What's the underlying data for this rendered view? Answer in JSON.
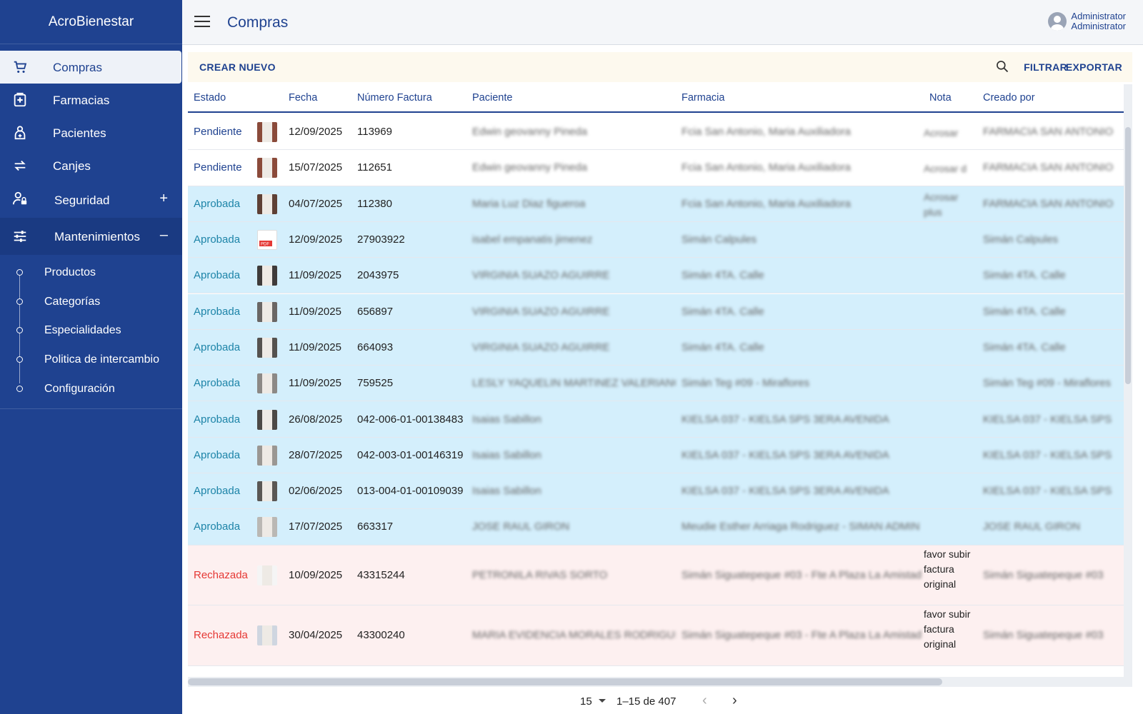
{
  "app": {
    "brand": "AcroBienestar"
  },
  "header": {
    "title": "Compras",
    "user_name": "Administrator",
    "user_role": "Administrator"
  },
  "sidebar": {
    "items": [
      {
        "label": "Compras",
        "icon": "cart-icon"
      },
      {
        "label": "Farmacias",
        "icon": "pharmacy-icon"
      },
      {
        "label": "Pacientes",
        "icon": "patient-icon"
      },
      {
        "label": "Canjes",
        "icon": "swap-icon"
      },
      {
        "label": "Seguridad",
        "icon": "user-lock-icon",
        "toggle": "+"
      },
      {
        "label": "Mantenimientos",
        "icon": "sliders-icon",
        "toggle": "–"
      }
    ],
    "submenu": [
      "Productos",
      "Categorías",
      "Especialidades",
      "Politica de intercambio",
      "Configuración"
    ]
  },
  "toolbar": {
    "create": "CREAR NUEVO",
    "filter": "FILTRAR",
    "export": "EXPORTAR"
  },
  "table": {
    "headers": {
      "estado": "Estado",
      "fecha": "Fecha",
      "numero": "Número Factura",
      "paciente": "Paciente",
      "farmacia": "Farmacia",
      "nota": "Nota",
      "creado": "Creado por"
    },
    "rows": [
      {
        "estado": "Pendiente",
        "status": "pend",
        "fecha": "12/09/2025",
        "numero": "113969",
        "paciente": "Edwin geovanny Pineda",
        "farmacia": "Fcia San Antonio, Maria Auxiliadora",
        "nota": "Acrosar",
        "creado": "FARMACIA SAN ANTONIO"
      },
      {
        "estado": "Pendiente",
        "status": "pend",
        "fecha": "15/07/2025",
        "numero": "112651",
        "paciente": "Edwin geovanny Pineda",
        "farmacia": "Fcia San Antonio, Maria Auxiliadora",
        "nota": "Acrosar d",
        "creado": "FARMACIA SAN ANTONIO"
      },
      {
        "estado": "Aprobada",
        "status": "apr",
        "fecha": "04/07/2025",
        "numero": "112380",
        "paciente": "Maria Luz Diaz figueroa",
        "farmacia": "Fcia San Antonio, Maria Auxiliadora",
        "nota": "Acrosar plus",
        "creado": "FARMACIA SAN ANTONIO"
      },
      {
        "estado": "Aprobada",
        "status": "apr",
        "fecha": "12/09/2025",
        "numero": "27903922",
        "paciente": "isabel empanatis jimenez",
        "farmacia": "Simán Calpules",
        "nota": "",
        "creado": "Simán Calpules"
      },
      {
        "estado": "Aprobada",
        "status": "apr",
        "fecha": "11/09/2025",
        "numero": "2043975",
        "paciente": "VIRGINIA SUAZO AGUIRRE",
        "farmacia": "Simán 4TA. Calle",
        "nota": "",
        "creado": "Simán 4TA. Calle"
      },
      {
        "estado": "Aprobada",
        "status": "apr",
        "fecha": "11/09/2025",
        "numero": "656897",
        "paciente": "VIRGINIA SUAZO AGUIRRE",
        "farmacia": "Simán 4TA. Calle",
        "nota": "",
        "creado": "Simán 4TA. Calle"
      },
      {
        "estado": "Aprobada",
        "status": "apr",
        "fecha": "11/09/2025",
        "numero": "664093",
        "paciente": "VIRGINIA SUAZO AGUIRRE",
        "farmacia": "Simán 4TA. Calle",
        "nota": "",
        "creado": "Simán 4TA. Calle"
      },
      {
        "estado": "Aprobada",
        "status": "apr",
        "fecha": "11/09/2025",
        "numero": "759525",
        "paciente": "LESLY YAQUELIN MARTINEZ VALERIANO",
        "farmacia": "Simán Teg #09 - Miraflores",
        "nota": "",
        "creado": "Simán Teg #09 - Miraflores"
      },
      {
        "estado": "Aprobada",
        "status": "apr",
        "fecha": "26/08/2025",
        "numero": "042-006-01-00138483",
        "paciente": "Isaias Sabillon",
        "farmacia": "KIELSA 037 - KIELSA SPS 3ERA AVENIDA",
        "nota": "",
        "creado": "KIELSA 037 - KIELSA SPS"
      },
      {
        "estado": "Aprobada",
        "status": "apr",
        "fecha": "28/07/2025",
        "numero": "042-003-01-00146319",
        "paciente": "Isaias Sabillon",
        "farmacia": "KIELSA 037 - KIELSA SPS 3ERA AVENIDA",
        "nota": "",
        "creado": "KIELSA 037 - KIELSA SPS"
      },
      {
        "estado": "Aprobada",
        "status": "apr",
        "fecha": "02/06/2025",
        "numero": "013-004-01-00109039",
        "paciente": "Isaias Sabillon",
        "farmacia": "KIELSA 037 - KIELSA SPS 3ERA AVENIDA",
        "nota": "",
        "creado": "KIELSA 037 - KIELSA SPS"
      },
      {
        "estado": "Aprobada",
        "status": "apr",
        "fecha": "17/07/2025",
        "numero": "663317",
        "paciente": "JOSE RAUL GIRON",
        "farmacia": "Meudie Esther Arriaga Rodriguez - SIMAN ADMIN",
        "nota": "",
        "creado": "JOSE RAUL GIRON"
      },
      {
        "estado": "Rechazada",
        "status": "rej",
        "fecha": "10/09/2025",
        "numero": "43315244",
        "paciente": "PETRONILA RIVAS SORTO",
        "farmacia": "Simán Siguatepeque #03 - Fte A Plaza La Amistad",
        "nota": "favor subir factura original",
        "creado": "Simán Siguatepeque #03"
      },
      {
        "estado": "Rechazada",
        "status": "rej",
        "fecha": "30/04/2025",
        "numero": "43300240",
        "paciente": "MARIA EVIDENCIA MORALES RODRIGUEZ",
        "farmacia": "Simán Siguatepeque #03 - Fte A Plaza La Amistad",
        "nota": "favor subir factura original",
        "creado": "Simán Siguatepeque #03"
      }
    ]
  },
  "pagination": {
    "page_size": "15",
    "range": "1–15 de 407"
  },
  "colors": {
    "sidebar": "#1f4290",
    "approved_row": "#d4effc",
    "rejected_row": "#fdf0f0",
    "approved_text": "#1d84a8",
    "rejected_text": "#e53935"
  }
}
